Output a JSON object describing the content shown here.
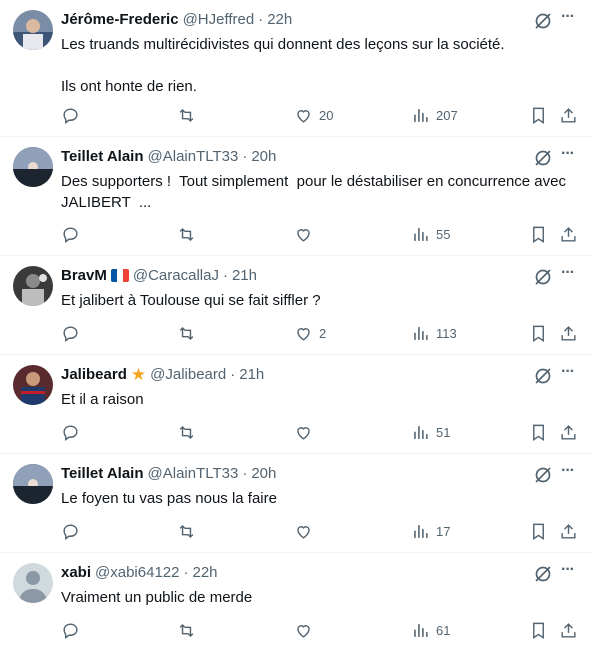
{
  "tweets": [
    {
      "name": "Jérôme-Frederic",
      "handle": "@HJeffred",
      "time": "22h",
      "text": "Les truands multirécidivistes qui donnent des leçons sur la société.\n\nIls ont honte de rien.",
      "replies": "",
      "retweets": "",
      "likes": "20",
      "views": "207",
      "avatar": "photo-person-icon"
    },
    {
      "name": "Teillet Alain",
      "handle": "@AlainTLT33",
      "time": "20h",
      "text": "Des supporters !  Tout simplement  pour le déstabiliser en concurrence avec JALIBERT  ...",
      "replies": "",
      "retweets": "",
      "likes": "",
      "views": "55",
      "avatar": "sunset-lake-icon"
    },
    {
      "name": "BravM",
      "handle": "@CaracallaJ",
      "time": "21h",
      "text": "Et jalibert à Toulouse qui se fait siffler ?",
      "replies": "",
      "retweets": "",
      "likes": "2",
      "views": "113",
      "avatar": "player-photo-icon",
      "badge": "french-flag-icon"
    },
    {
      "name": "Jalibeard",
      "handle": "@Jalibeard",
      "time": "21h",
      "text": "Et il a raison",
      "replies": "",
      "retweets": "",
      "likes": "",
      "views": "51",
      "avatar": "rugby-player-icon",
      "badge": "star-icon"
    },
    {
      "name": "Teillet Alain",
      "handle": "@AlainTLT33",
      "time": "20h",
      "text": "Le foyen tu vas pas nous la faire",
      "replies": "",
      "retweets": "",
      "likes": "",
      "views": "17",
      "avatar": "sunset-lake-icon"
    },
    {
      "name": "xabi",
      "handle": "@xabi64122",
      "time": "22h",
      "text": "Vraiment un public de merde",
      "replies": "",
      "retweets": "",
      "likes": "",
      "views": "61",
      "avatar": "default-avatar-icon"
    }
  ],
  "dot": "·",
  "more_label": "···"
}
